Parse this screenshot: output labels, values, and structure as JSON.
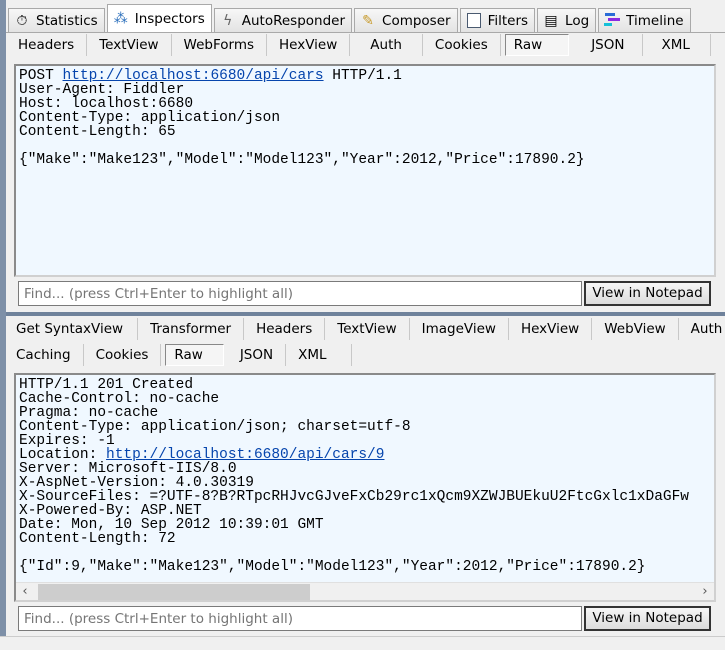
{
  "top_tabs": [
    {
      "label": "Statistics",
      "icon": "stopwatch-icon"
    },
    {
      "label": "Inspectors",
      "icon": "inspectors-icon",
      "active": true
    },
    {
      "label": "AutoResponder",
      "icon": "lightning-icon"
    },
    {
      "label": "Composer",
      "icon": "composer-pencil-icon"
    },
    {
      "label": "Filters",
      "icon": "checkbox-icon"
    },
    {
      "label": "Log",
      "icon": "log-document-icon"
    },
    {
      "label": "Timeline",
      "icon": "timeline-icon"
    }
  ],
  "request": {
    "tabs": [
      "Headers",
      "TextView",
      "WebForms",
      "HexView",
      "Auth",
      "Cookies",
      "Raw",
      "JSON",
      "XML"
    ],
    "active_tab": "Raw",
    "method": "POST",
    "url": "http://localhost:6680/api/cars",
    "protocol": "HTTP/1.1",
    "headers": [
      "User-Agent: Fiddler",
      "Host: localhost:6680",
      "Content-Type: application/json",
      "Content-Length: 65"
    ],
    "body": "{\"Make\":\"Make123\",\"Model\":\"Model123\",\"Year\":2012,\"Price\":17890.2}",
    "find_placeholder": "Find... (press Ctrl+Enter to highlight all)",
    "notepad_button": "View in Notepad"
  },
  "response": {
    "tabs_row1": [
      "Get SyntaxView",
      "Transformer",
      "Headers",
      "TextView",
      "ImageView",
      "HexView",
      "WebView",
      "Auth"
    ],
    "tabs_row2": [
      "Caching",
      "Cookies",
      "Raw",
      "JSON",
      "XML"
    ],
    "active_tab": "Raw",
    "headers_before_location": [
      "HTTP/1.1 201 Created",
      "Cache-Control: no-cache",
      "Pragma: no-cache",
      "Content-Type: application/json; charset=utf-8",
      "Expires: -1"
    ],
    "location_label": "Location: ",
    "location_url": "http://localhost:6680/api/cars/9",
    "headers_after_location": [
      "Server: Microsoft-IIS/8.0",
      "X-AspNet-Version: 4.0.30319",
      "X-SourceFiles: =?UTF-8?B?RTpcRHJvcGJveFxCb29rc1xQcm9XZWJBUEkuU2FtcGxlc1xDaGFw",
      "X-Powered-By: ASP.NET",
      "Date: Mon, 10 Sep 2012 10:39:01 GMT",
      "Content-Length: 72"
    ],
    "body": "{\"Id\":9,\"Make\":\"Make123\",\"Model\":\"Model123\",\"Year\":2012,\"Price\":17890.2}",
    "horizontal_scroll_fraction": 0.39,
    "find_placeholder": "Find... (press Ctrl+Enter to highlight all)",
    "notepad_button": "View in Notepad"
  }
}
